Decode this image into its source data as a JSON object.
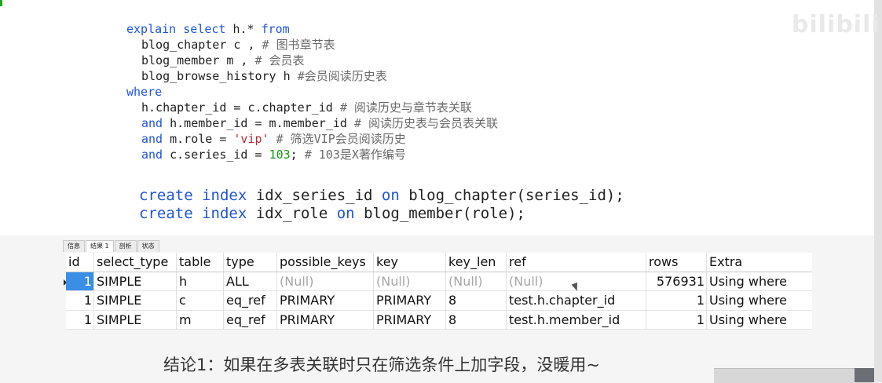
{
  "logo_text": "bilibili",
  "sql": {
    "l1": {
      "kw1": "explain",
      "kw2": "select",
      "tx": "h.*",
      "kw3": "from"
    },
    "l2": {
      "tx": "blog_chapter c ,",
      "cm": "# 图书章节表"
    },
    "l3": {
      "tx": "blog_member m ,",
      "cm": "# 会员表"
    },
    "l4": {
      "tx": "blog_browse_history h",
      "cm": "#会员阅读历史表"
    },
    "l5": {
      "kw": "where"
    },
    "l6": {
      "tx": "h.chapter_id = c.chapter_id",
      "cm": "# 阅读历史与章节表关联"
    },
    "l7": {
      "kw": "and",
      "tx": "h.member_id = m.member_id",
      "cm": "# 阅读历史表与会员表关联"
    },
    "l8": {
      "kw": "and",
      "tx": "m.role =",
      "st": "'vip'",
      "cm": "# 筛选VIP会员阅读历史"
    },
    "l9": {
      "kw": "and",
      "tx": "c.series_id =",
      "nm": "103",
      "semi": ";",
      "cm": "# 103是X著作编号"
    }
  },
  "index_sql": {
    "i1": {
      "kw1": "create",
      "kw2": "index",
      "tx1": "idx_series_id",
      "kw3": "on",
      "tx2": "blog_chapter(series_id);"
    },
    "i2": {
      "kw1": "create",
      "kw2": "index",
      "tx1": "idx_role",
      "kw3": "on",
      "tx2": "blog_member(role);"
    }
  },
  "tabs": [
    "信息",
    "结果 1",
    "剖析",
    "状态"
  ],
  "active_tab": "结果 1",
  "grid": {
    "headers": [
      "id",
      "select_type",
      "table",
      "type",
      "possible_keys",
      "key",
      "key_len",
      "ref",
      "rows",
      "Extra"
    ],
    "rows": [
      [
        "1",
        "SIMPLE",
        "h",
        "ALL",
        "(Null)",
        "(Null)",
        "(Null)",
        "(Null)",
        "576931",
        "Using where"
      ],
      [
        "1",
        "SIMPLE",
        "c",
        "eq_ref",
        "PRIMARY",
        "PRIMARY",
        "8",
        "test.h.chapter_id",
        "1",
        "Using where"
      ],
      [
        "1",
        "SIMPLE",
        "m",
        "eq_ref",
        "PRIMARY",
        "PRIMARY",
        "8",
        "test.h.member_id",
        "1",
        "Using where"
      ]
    ]
  },
  "caption": "结论1：如果在多表关联时只在筛选条件上加字段，没暖用~",
  "colors": {
    "keyword": "#1f55d6",
    "comment": "#6a6a6a",
    "string": "#c0282d",
    "number": "#139913",
    "selection": "#3a8ee6"
  }
}
